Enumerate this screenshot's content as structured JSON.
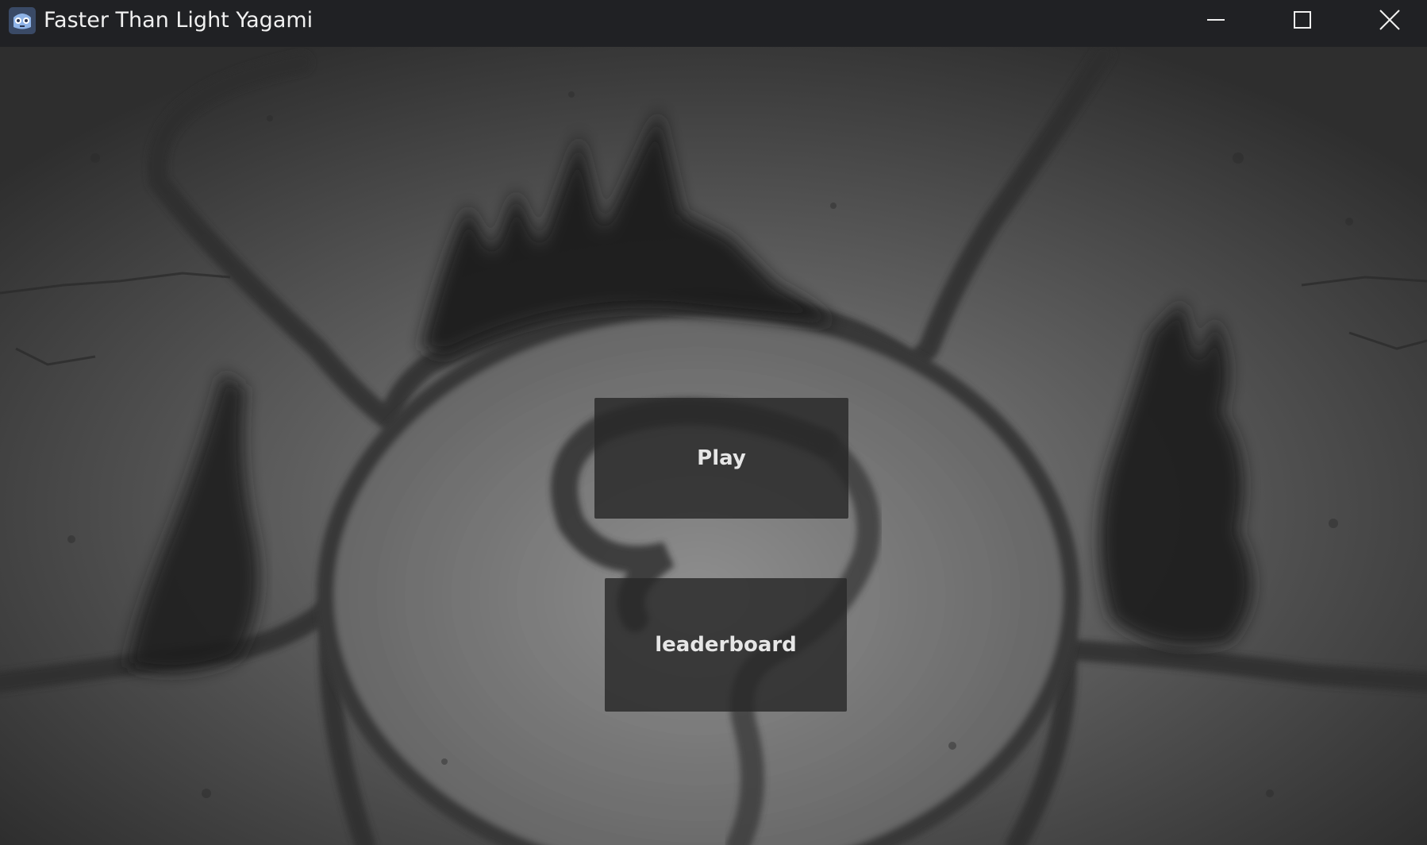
{
  "window": {
    "title": "Faster Than Light Yagami",
    "app_icon": "godot-robot-icon",
    "controls": {
      "minimize_icon": "minimize-icon",
      "maximize_icon": "maximize-icon",
      "close_icon": "close-icon"
    }
  },
  "main_menu": {
    "play_label": "Play",
    "leaderboard_label": "leaderboard"
  },
  "colors": {
    "titlebar": "#202124",
    "button_bg": "#2b2b2b",
    "button_text": "#e6e6e6",
    "background_stone": "#4a4a4a"
  }
}
